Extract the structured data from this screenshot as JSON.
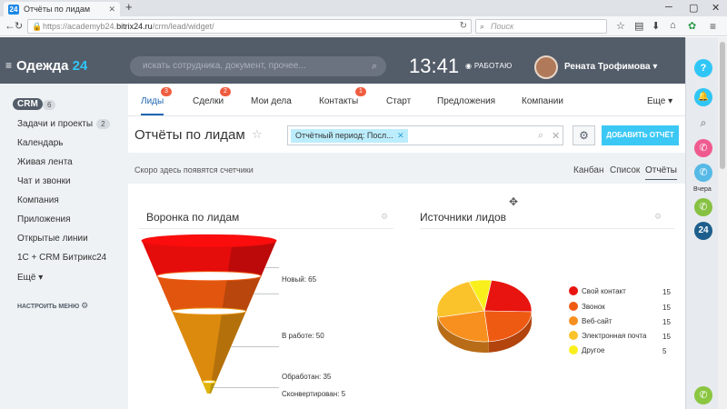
{
  "browser": {
    "tab_title": "Отчёты по лидам",
    "tab_favicon": "24",
    "url_prefix": "https://academyb24.",
    "url_domain": "bitrix24.ru",
    "url_path": "/crm/lead/widget/",
    "search_placeholder": "Поиск"
  },
  "header": {
    "logo_main": "Одежда",
    "logo_num": "24",
    "search_placeholder": "искать сотрудника, документ, прочее...",
    "clock": "13:41",
    "status": "РАБОТАЮ",
    "user_name": "Рената Трофимова"
  },
  "rail": {
    "label_yesterday": "Вчера",
    "help": "?",
    "b24": "24"
  },
  "sidebar": {
    "crm_label": "CRM",
    "crm_count": "6",
    "items": [
      {
        "label": "Задачи и проекты",
        "count": "2"
      },
      {
        "label": "Календарь"
      },
      {
        "label": "Живая лента"
      },
      {
        "label": "Чат и звонки"
      },
      {
        "label": "Компания"
      },
      {
        "label": "Приложения"
      },
      {
        "label": "Открытые линии"
      },
      {
        "label": "1С + CRM Битрикс24"
      },
      {
        "label": "Ещё ▾"
      }
    ],
    "configure_menu": "НАСТРОИТЬ МЕНЮ"
  },
  "tabs": [
    {
      "label": "Лиды",
      "badge": "3"
    },
    {
      "label": "Сделки",
      "badge": "2"
    },
    {
      "label": "Мои дела"
    },
    {
      "label": "Контакты",
      "badge": "1"
    },
    {
      "label": "Старт"
    },
    {
      "label": "Предложения"
    },
    {
      "label": "Компании"
    },
    {
      "label": "Еще ▾"
    }
  ],
  "toolbar": {
    "page_title": "Отчёты по лидам",
    "filter_chip": "Отчётный период: Посл...",
    "add_report": "ДОБАВИТЬ ОТЧЁТ"
  },
  "counters": {
    "coming_soon": "Скоро здесь появятся счетчики",
    "view_kanban": "Канбан",
    "view_list": "Список",
    "view_reports": "Отчёты"
  },
  "widgets": {
    "funnel_title": "Воронка по лидам",
    "sources_title": "Источники лидов"
  },
  "chart_data": [
    {
      "type": "funnel",
      "title": "Воронка по лидам",
      "stages": [
        {
          "label": "Новый",
          "value": 65,
          "color": "#e50c0c"
        },
        {
          "label": "В работе",
          "value": 50,
          "color": "#e2550f"
        },
        {
          "label": "Обработан",
          "value": 35,
          "color": "#dc8a0e"
        },
        {
          "label": "Сконвертирован",
          "value": 5,
          "color": "#e0b40c"
        }
      ]
    },
    {
      "type": "pie",
      "title": "Источники лидов",
      "slices": [
        {
          "label": "Свой контакт",
          "value": 15,
          "color": "#e8140f"
        },
        {
          "label": "Звонок",
          "value": 15,
          "color": "#ef5a13"
        },
        {
          "label": "Веб-сайт",
          "value": 15,
          "color": "#f7901e"
        },
        {
          "label": "Электронная почта",
          "value": 15,
          "color": "#fbc32b"
        },
        {
          "label": "Другое",
          "value": 5,
          "color": "#f9ef1c"
        }
      ]
    }
  ]
}
